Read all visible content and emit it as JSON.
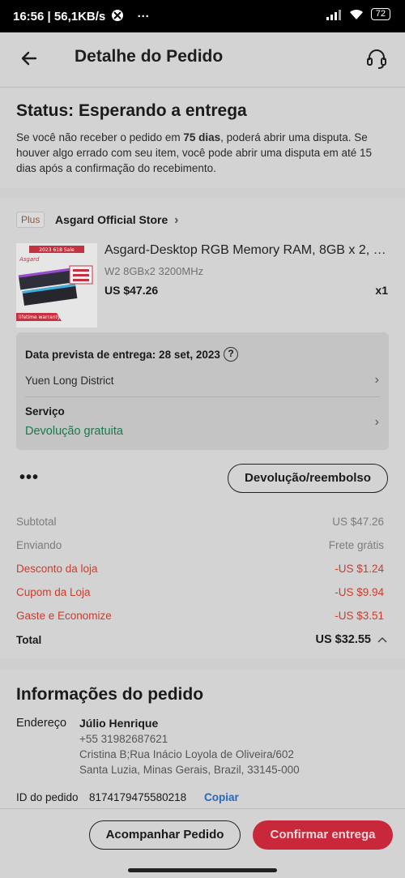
{
  "statusbar": {
    "time": "16:56 | 56,1KB/s",
    "dots": "···",
    "battery": "72"
  },
  "header": {
    "title": "Detalhe do Pedido"
  },
  "status": {
    "title": "Status: Esperando a entrega",
    "desc_pre": "Se você não receber o pedido em ",
    "desc_bold": "75 dias",
    "desc_post": ", poderá abrir uma disputa. Se houver algo errado com seu item, você pode abrir uma disputa em até 15 dias após a confirmação do recebimento."
  },
  "store": {
    "badge": "Plus",
    "name": "Asgard Official Store"
  },
  "product": {
    "name": "Asgard-Desktop RGB Memory RAM, 8GB x 2, 1...",
    "variant": "W2 8GBx2 3200MHz",
    "price": "US $47.26",
    "qty": "x1",
    "img_brand": "Asgard",
    "img_sale": "2023 618 Sale",
    "img_warranty": "lifetime warranty"
  },
  "delivery": {
    "expected": "Data prevista de entrega: 28 set, 2023",
    "help": "?",
    "district": "Yuen Long District",
    "service_label": "Serviço",
    "service_value": "Devolução gratuita"
  },
  "actions": {
    "more": "•••",
    "return_label": "Devolução/reembolso"
  },
  "summary": {
    "subtotal_label": "Subtotal",
    "subtotal_value": "US $47.26",
    "shipping_label": "Enviando",
    "shipping_value": "Frete grátis",
    "store_discount_label": "Desconto da loja",
    "store_discount_value": "-US $1.24",
    "coupon_label": "Cupom da Loja",
    "coupon_value": "-US $9.94",
    "save_label": "Gaste e Economize",
    "save_value": "-US $3.51",
    "total_label": "Total",
    "total_value": "US $32.55"
  },
  "info": {
    "title": "Informações do pedido",
    "address_label": "Endereço",
    "name": "Júlio Henrique",
    "phone": "+55 31982687621",
    "street": "Cristina B;Rua Inácio Loyola de Oliveira/602",
    "city": "Santa Luzia, Minas Gerais, Brazil, 33145-000",
    "order_id_label": "ID do pedido",
    "order_id": "8174179475580218",
    "copy_label": "Copiar"
  },
  "bottom": {
    "track_label": "Acompanhar Pedido",
    "confirm_label": "Confirmar entrega"
  },
  "colors": {
    "accent_red": "#c8283a",
    "discount_red": "#d23a2a",
    "service_green": "#187a4a",
    "link_blue": "#2568c0"
  }
}
